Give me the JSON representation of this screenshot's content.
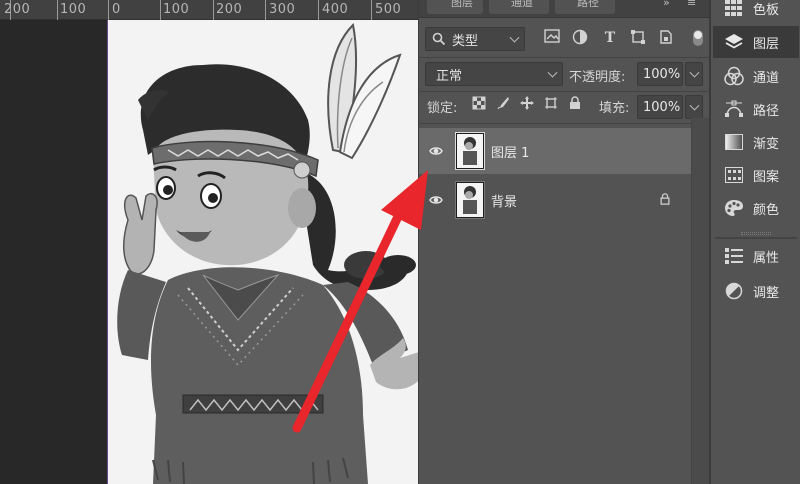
{
  "ruler": {
    "labels": [
      "200",
      "100",
      "0",
      "100",
      "200",
      "300",
      "400",
      "500"
    ]
  },
  "panel": {
    "tab_labels": [
      "图层",
      "通道",
      "路径"
    ],
    "filter": {
      "kind_label": "类型"
    },
    "blend_mode": "正常",
    "opacity": {
      "label": "不透明度:",
      "value": "100%"
    },
    "lock": {
      "label": "锁定:"
    },
    "fill": {
      "label": "填充:",
      "value": "100%"
    },
    "layers": [
      {
        "name": "图层 1",
        "visible": true,
        "selected": true,
        "locked": false
      },
      {
        "name": "背景",
        "visible": true,
        "selected": false,
        "locked": true
      }
    ]
  },
  "dock": {
    "items": [
      {
        "label": "色板",
        "icon": "swatches-icon"
      },
      {
        "label": "图层",
        "icon": "layers-icon",
        "active": true
      },
      {
        "label": "通道",
        "icon": "channels-icon"
      },
      {
        "label": "路径",
        "icon": "paths-icon"
      },
      {
        "label": "渐变",
        "icon": "gradient-icon"
      },
      {
        "label": "图案",
        "icon": "patterns-icon"
      },
      {
        "label": "颜色",
        "icon": "color-icon"
      },
      {
        "label": "属性",
        "icon": "properties-icon"
      },
      {
        "label": "调整",
        "icon": "adjustments-icon"
      }
    ]
  },
  "colors": {
    "arrow": "#e8262b",
    "panel_bg": "#535353",
    "selected_layer": "#6a6a6a"
  }
}
